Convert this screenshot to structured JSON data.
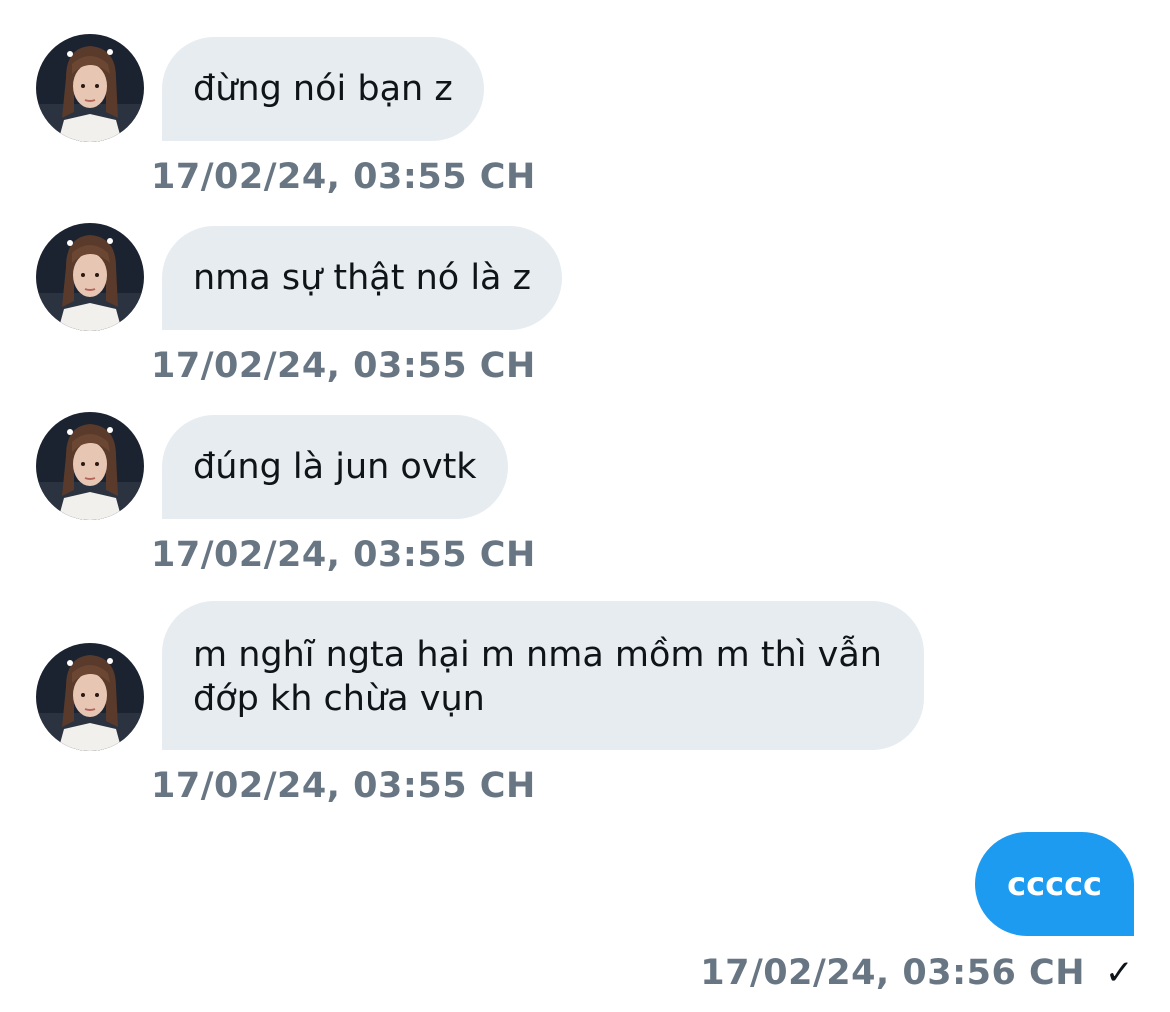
{
  "conversation": {
    "received": [
      {
        "text": "đừng nói bạn z",
        "timestamp": "17/02/24, 03:55 CH"
      },
      {
        "text": "nma sự thật nó là z",
        "timestamp": "17/02/24, 03:55 CH"
      },
      {
        "text": "đúng là jun ovtk",
        "timestamp": "17/02/24, 03:55 CH"
      },
      {
        "line1": "m nghĩ ngta hại m nma mồm m thì vẫn",
        "line2": "đớp kh chừa vụn",
        "timestamp": "17/02/24, 03:55 CH"
      }
    ],
    "sent": {
      "text": "ccccc",
      "timestamp": "17/02/24, 03:56 CH",
      "status_icon": "checkmark-icon"
    }
  },
  "colors": {
    "received_bubble": "#e7ecf0",
    "sent_bubble": "#1d9bf0",
    "timestamp": "#687684"
  }
}
